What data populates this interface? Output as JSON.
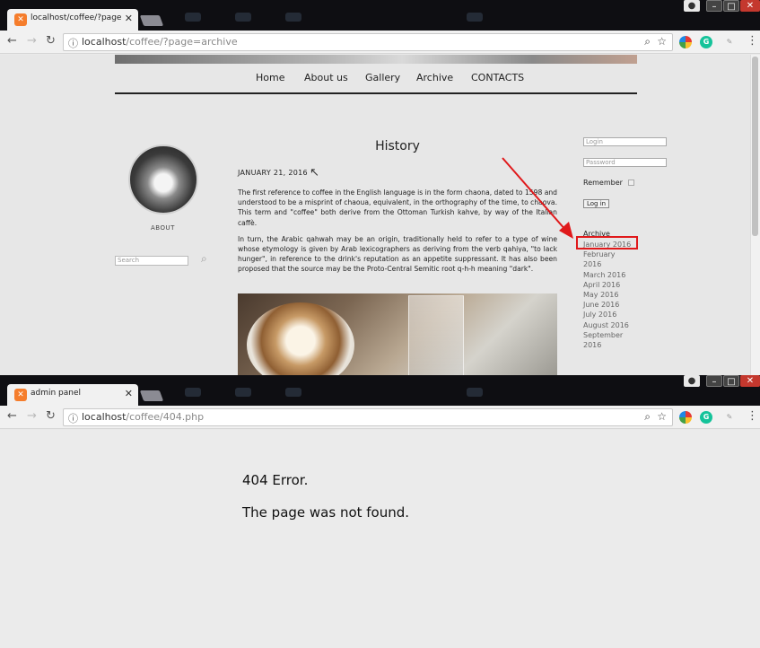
{
  "window1": {
    "tab_title": "localhost/coffee/?page=ar",
    "url_host": "localhost",
    "url_path": "/coffee/?page=archive",
    "nav_items": [
      "Home",
      "About us",
      "Gallery",
      "Archive",
      "CONTACTS"
    ],
    "sidebar_left": {
      "about_label": "ABOUT",
      "search_placeholder": "Search"
    },
    "post": {
      "title": "History",
      "date": "JANUARY 21, 2016",
      "paragraphs": [
        "The first reference to coffee in the English language is in the form chaona, dated to 1598 and understood to be a misprint of chaoua, equivalent, in the orthography of the time, to chaova. This term and \"coffee\" both derive from the Ottoman Turkish kahve, by way of the Italian caffè.",
        "In turn, the Arabic qahwah may be an origin, traditionally held to refer to a type of wine whose etymology is given by Arab lexicographers as deriving from the verb qahiya, \"to lack hunger\", in reference to the drink's reputation as an appetite suppressant. It has also been proposed that the source may be the Proto-Central Semitic root q-h-h meaning \"dark\"."
      ]
    },
    "sidebar_right": {
      "login_placeholder": "Login",
      "password_placeholder": "Password",
      "remember_label": "Remember",
      "login_button": "Log in",
      "archive_heading": "Archive",
      "archive_items": [
        "January 2016",
        "February 2016",
        "March 2016",
        "April 2016",
        "May 2016",
        "June 2016",
        "July 2016",
        "August 2016",
        "September 2016"
      ]
    },
    "annotation_color": "#e0191b"
  },
  "window2": {
    "tab_title": "admin panel",
    "url_host": "localhost",
    "url_path": "/coffee/404.php",
    "error_line1": "404 Error.",
    "error_line2": "The page was not found."
  },
  "icons": [
    "favicon-xampp-icon",
    "back-arrow-icon",
    "forward-arrow-icon",
    "reload-icon",
    "info-icon",
    "zoom-icon",
    "bookmark-star-icon",
    "search-icon",
    "menu-dots-icon"
  ]
}
